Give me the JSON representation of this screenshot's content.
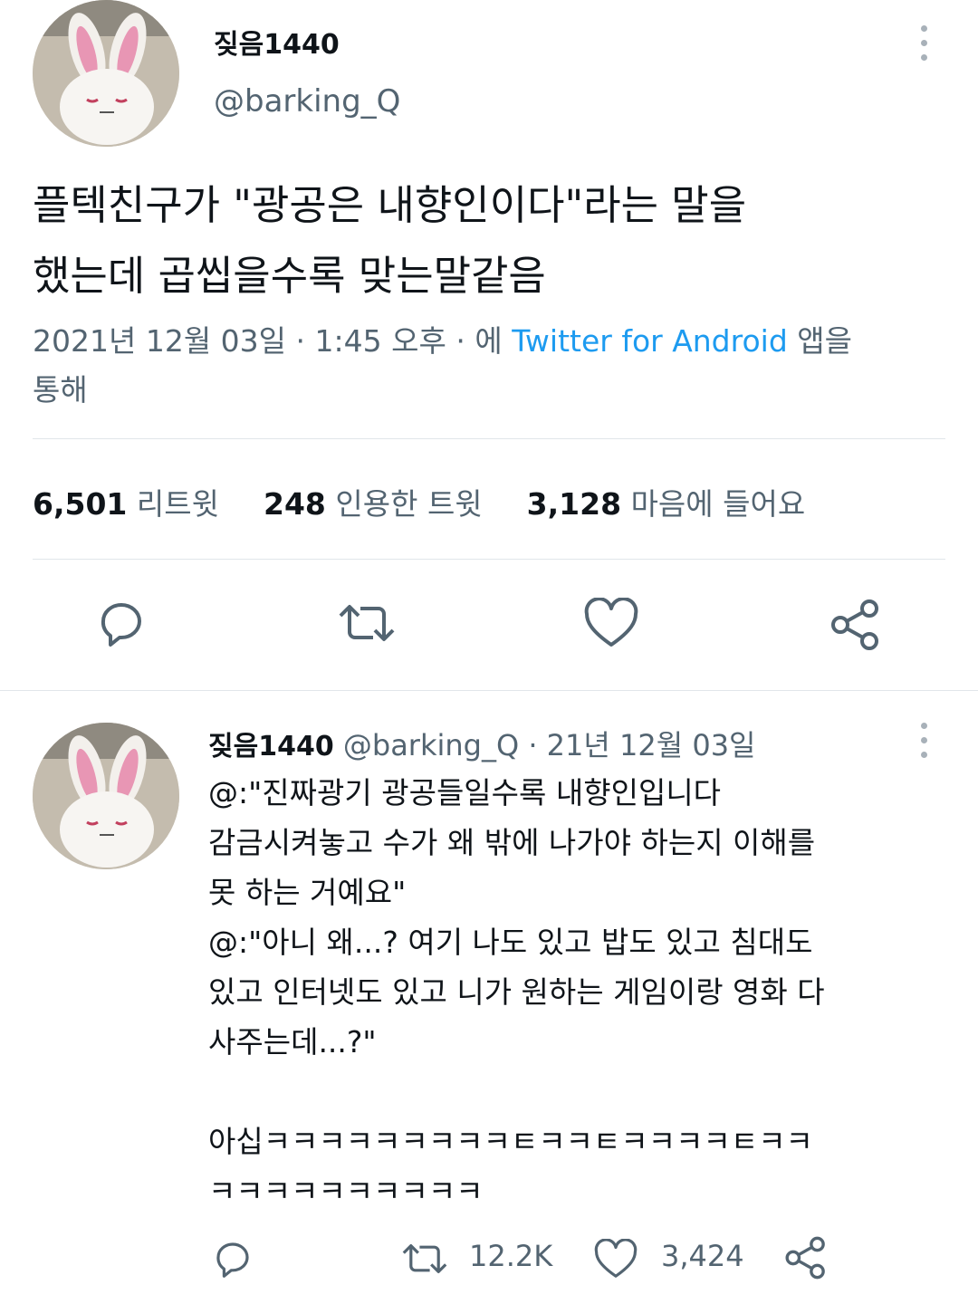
{
  "main_tweet": {
    "display_name": "짖음1440",
    "handle": "@barking_Q",
    "text_line1": "플텍친구가 \"광공은 내향인이다\"라는 말을",
    "text_line2": "했는데 곱씹을수록 맞는말같음",
    "meta": {
      "date": "2021년 12월 03일",
      "sep1": "·",
      "time": "1:45 오후",
      "sep2": "·",
      "via_prefix": "에",
      "client": "Twitter for Android",
      "via_suffix": "앱을",
      "via_suffix2": "통해"
    },
    "stats": {
      "retweets_count": "6,501",
      "retweets_label": "리트윗",
      "quotes_count": "248",
      "quotes_label": "인용한 트윗",
      "likes_count": "3,128",
      "likes_label": "마음에 들어요"
    },
    "icons": [
      "reply-icon",
      "retweet-icon",
      "like-icon",
      "share-icon"
    ]
  },
  "reply_tweet": {
    "display_name": "짖음1440",
    "handle": "@barking_Q",
    "sep": "·",
    "date": "21년 12월 03일",
    "lines": [
      "@:\"진짜광기 광공들일수록 내향인입니다",
      "감금시켜놓고 수가 왜 밖에 나가야 하는지 이해를",
      "못 하는 거예요\"",
      "@:\"아니 왜...? 여기 나도 있고 밥도 있고 침대도",
      "있고 인터넷도 있고 니가 원하는 게임이랑 영화 다",
      "사주는데...?\""
    ],
    "closing_lines": [
      "아십ㅋㅋㅋㅋㅋㅋㅋㅋㅋㅌㅋㅋㅌㅋㅋㅋㅋㅌㅋㅋ",
      "ㅋㅋㅋㅋㅋㅋㅋㅋㅋㅋ"
    ],
    "actions": {
      "retweets": "12.2K",
      "likes": "3,424"
    }
  }
}
